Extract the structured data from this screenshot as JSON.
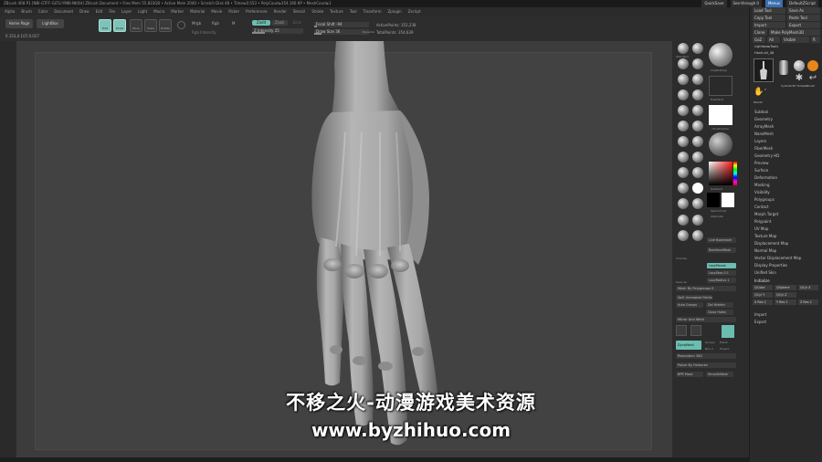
{
  "titlebar": {
    "text": "ZBrush 4R8 P1 [NBI-GTFF-GLTG-YMKI-NKXH]   ZBrush Document   • Free Mem 55.833GB • Active Mem 2040 • Scratch Disk 48 • Timer▸0.553 • PolyCount▸354.166 KP • MeshCount▸1",
    "right_buttons": [
      "QuickSave",
      "See-through 0",
      "Menus",
      "DefaultZScript"
    ]
  },
  "menubar": [
    "Alpha",
    "Brush",
    "Color",
    "Document",
    "Draw",
    "Edit",
    "File",
    "Layer",
    "Light",
    "Macro",
    "Marker",
    "Material",
    "Movie",
    "Picker",
    "Preferences",
    "Render",
    "Stencil",
    "Stroke",
    "Texture",
    "Tool",
    "Transform",
    "Zplugin",
    "Zscript"
  ],
  "toolbar": {
    "left_buttons": [
      "Home Page",
      "LightBox"
    ],
    "coords": "0.153,0.107,0.027",
    "tools": [
      {
        "label": "Edit",
        "active": true
      },
      {
        "label": "Draw",
        "active": true
      },
      {
        "label": "Move",
        "active": false
      },
      {
        "label": "Scale",
        "active": false
      },
      {
        "label": "Rotate",
        "active": false
      }
    ],
    "mrgb": "Mrgb",
    "rgb": "Rgb",
    "m": "M",
    "rgb_intensity": "Rgb Intensity",
    "zadd": "Zadd",
    "zsub": "Zsub",
    "zcut": "Zcut",
    "z_intensity": "Z Intensity 25",
    "focal_shift": "Focal Shift -94",
    "draw_size": "Draw Size 36",
    "dynamic": "Dynamic",
    "active_points": "ActivePoints: 352,238",
    "total_points": "TotalPoints: 354,639"
  },
  "tool_palette": {
    "brush_labels": [
      "Standard",
      "ClayBuildup",
      "Move",
      "DamStandard",
      "Move To.",
      "Inflat",
      "TrimDynamic",
      "hPolish",
      "Orb_Cracks",
      "Pinch",
      "Dam_Std"
    ],
    "big_brush_label": "ClayBuildup",
    "stroke_label": "FreeHand",
    "alpha_label": "~BrushAlpha",
    "texture_label": "Texture Off",
    "material_label": "MatCap Gray",
    "gradient_label": "Gradient",
    "switch_color": "SwitchColor",
    "alternate": "Alternate",
    "rows": [
      {
        "label": "Line Bookmark"
      },
      {
        "label": "BackfaceMask"
      },
      {
        "label": "Colorize"
      },
      {
        "label": "LazyMouse",
        "on": true
      },
      {
        "label": "LazyStep 0.1"
      },
      {
        "label": "LazyRadius 1"
      }
    ],
    "save_as": "Save As",
    "mesh_by_polygroups": "Mesh By Polygroups  0",
    "split_unmasked": "Split Unmasked Points",
    "split_hidden": "Del Hidden",
    "auto_groups": "Auto Groups",
    "close_holes": "Close Holes",
    "mirror_and_weld": "Mirror And Weld",
    "dynamesh": "DynaMesh",
    "groups": "Groups",
    "polish": "Polish",
    "blur": "Blur 2",
    "project": "Project",
    "resolution": "Resolution 380",
    "polish_features": "Polish By Features",
    "bpr": "BPR Mask",
    "smooth_mask": "SmoothMask"
  },
  "right_panel": {
    "top_buttons": [
      [
        "Load Tool",
        "Save As"
      ],
      [
        "Copy Tool",
        "Paste Tool"
      ],
      [
        "Import",
        "Export"
      ],
      [
        "Clone",
        "Make PolyMesh3D"
      ],
      [
        "GoZ",
        "All",
        "Visible",
        "R"
      ]
    ],
    "lightbox_tools": "Lightbox▸Tools",
    "tool_name": "Hand.ztl_48",
    "thumb_labels": [
      "Hand",
      "Cylinder3D",
      "SimpleBrush",
      "PolyMesh3D",
      "Handlr"
    ],
    "subtool_count": "2",
    "menus": [
      "Subtool",
      "Geometry",
      "ArrayMesh",
      "NanoMesh",
      "Layers",
      "FiberMesh",
      "Geometry HD",
      "Preview",
      "Surface",
      "Deformation",
      "Masking",
      "Visibility",
      "Polygroups",
      "Contact",
      "Morph Target",
      "Polypaint",
      "UV Map",
      "Texture Map",
      "Displacement Map",
      "Normal Map",
      "Vector Displacement Map",
      "Display Properties",
      "Unified Skin",
      "Initialize"
    ],
    "initialize_btns": [
      "QCube",
      "QSphere",
      "QCyl X",
      "QCyl Y",
      "QCyl Z",
      "X Res 2",
      "Y Res 2",
      "Z Res 2"
    ],
    "bottom_menus": [
      "Import",
      "Export"
    ]
  },
  "watermark": {
    "cn": "不移之火-动漫游戏美术资源",
    "url": "www.byzhihuo.com"
  }
}
